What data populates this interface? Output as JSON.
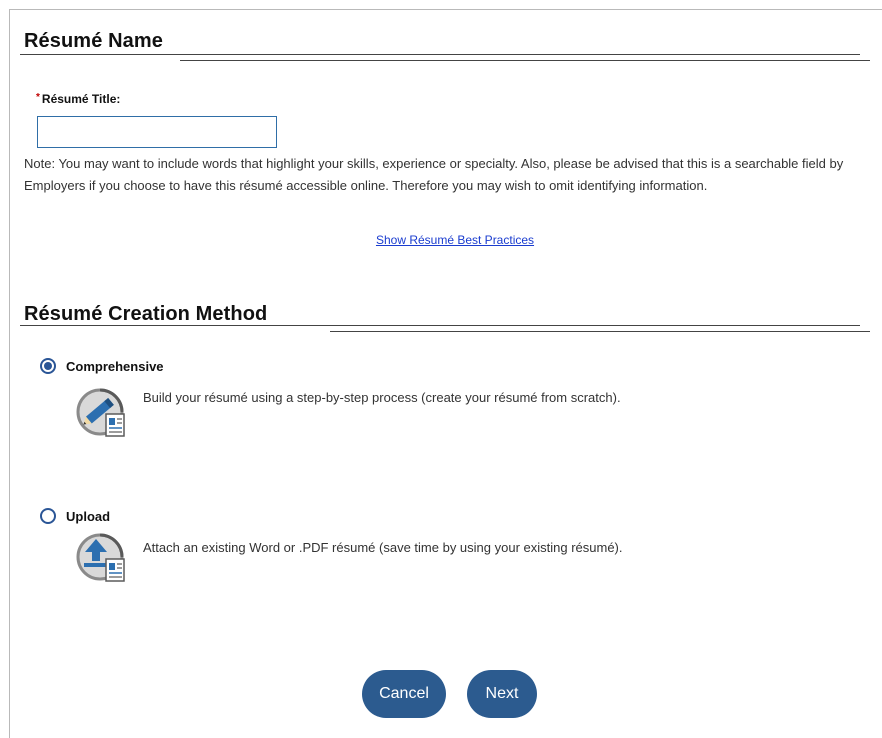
{
  "sections": {
    "resume_name": {
      "title": "Résumé Name",
      "required_marker": "*",
      "field_label": "Résumé Title:",
      "field_value": "",
      "note": "Note: You may want to include words that highlight your skills, experience or specialty. Also, please be advised that this is a searchable field by Employers if you choose to have this résumé accessible online. Therefore you may wish to omit identifying information.",
      "best_practices_link": "Show Résumé Best Practices"
    },
    "creation_method": {
      "title": "Résumé Creation Method",
      "options": [
        {
          "label": "Comprehensive",
          "selected": true,
          "icon": "pencil-document-icon",
          "description": "Build your résumé using a step-by-step process (create your résumé from scratch)."
        },
        {
          "label": "Upload",
          "selected": false,
          "icon": "upload-document-icon",
          "description": "Attach an existing Word or .PDF résumé (save time by using your existing résumé)."
        }
      ]
    }
  },
  "buttons": {
    "cancel": "Cancel",
    "next": "Next"
  },
  "colors": {
    "accent": "#2c5b8f",
    "link": "#1a3ccf",
    "required": "#c00000"
  }
}
